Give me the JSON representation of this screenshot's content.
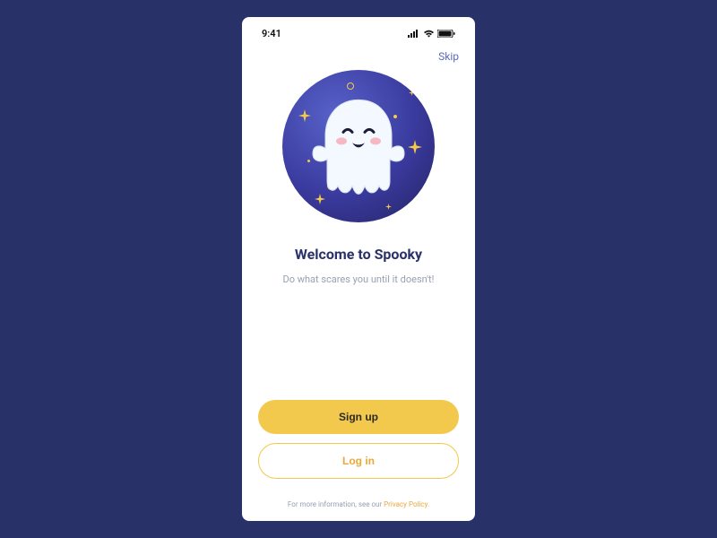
{
  "status": {
    "time": "9:41"
  },
  "actions": {
    "skip": "Skip"
  },
  "hero": {
    "title": "Welcome to Spooky",
    "subtitle": "Do what scares you until it doesn't!"
  },
  "buttons": {
    "signup": "Sign up",
    "login": "Log in"
  },
  "footer": {
    "prefix": "For more information, see our ",
    "link": "Privacy Policy",
    "suffix": "."
  },
  "colors": {
    "accent": "#f2c94c",
    "brand": "#2a3269"
  }
}
